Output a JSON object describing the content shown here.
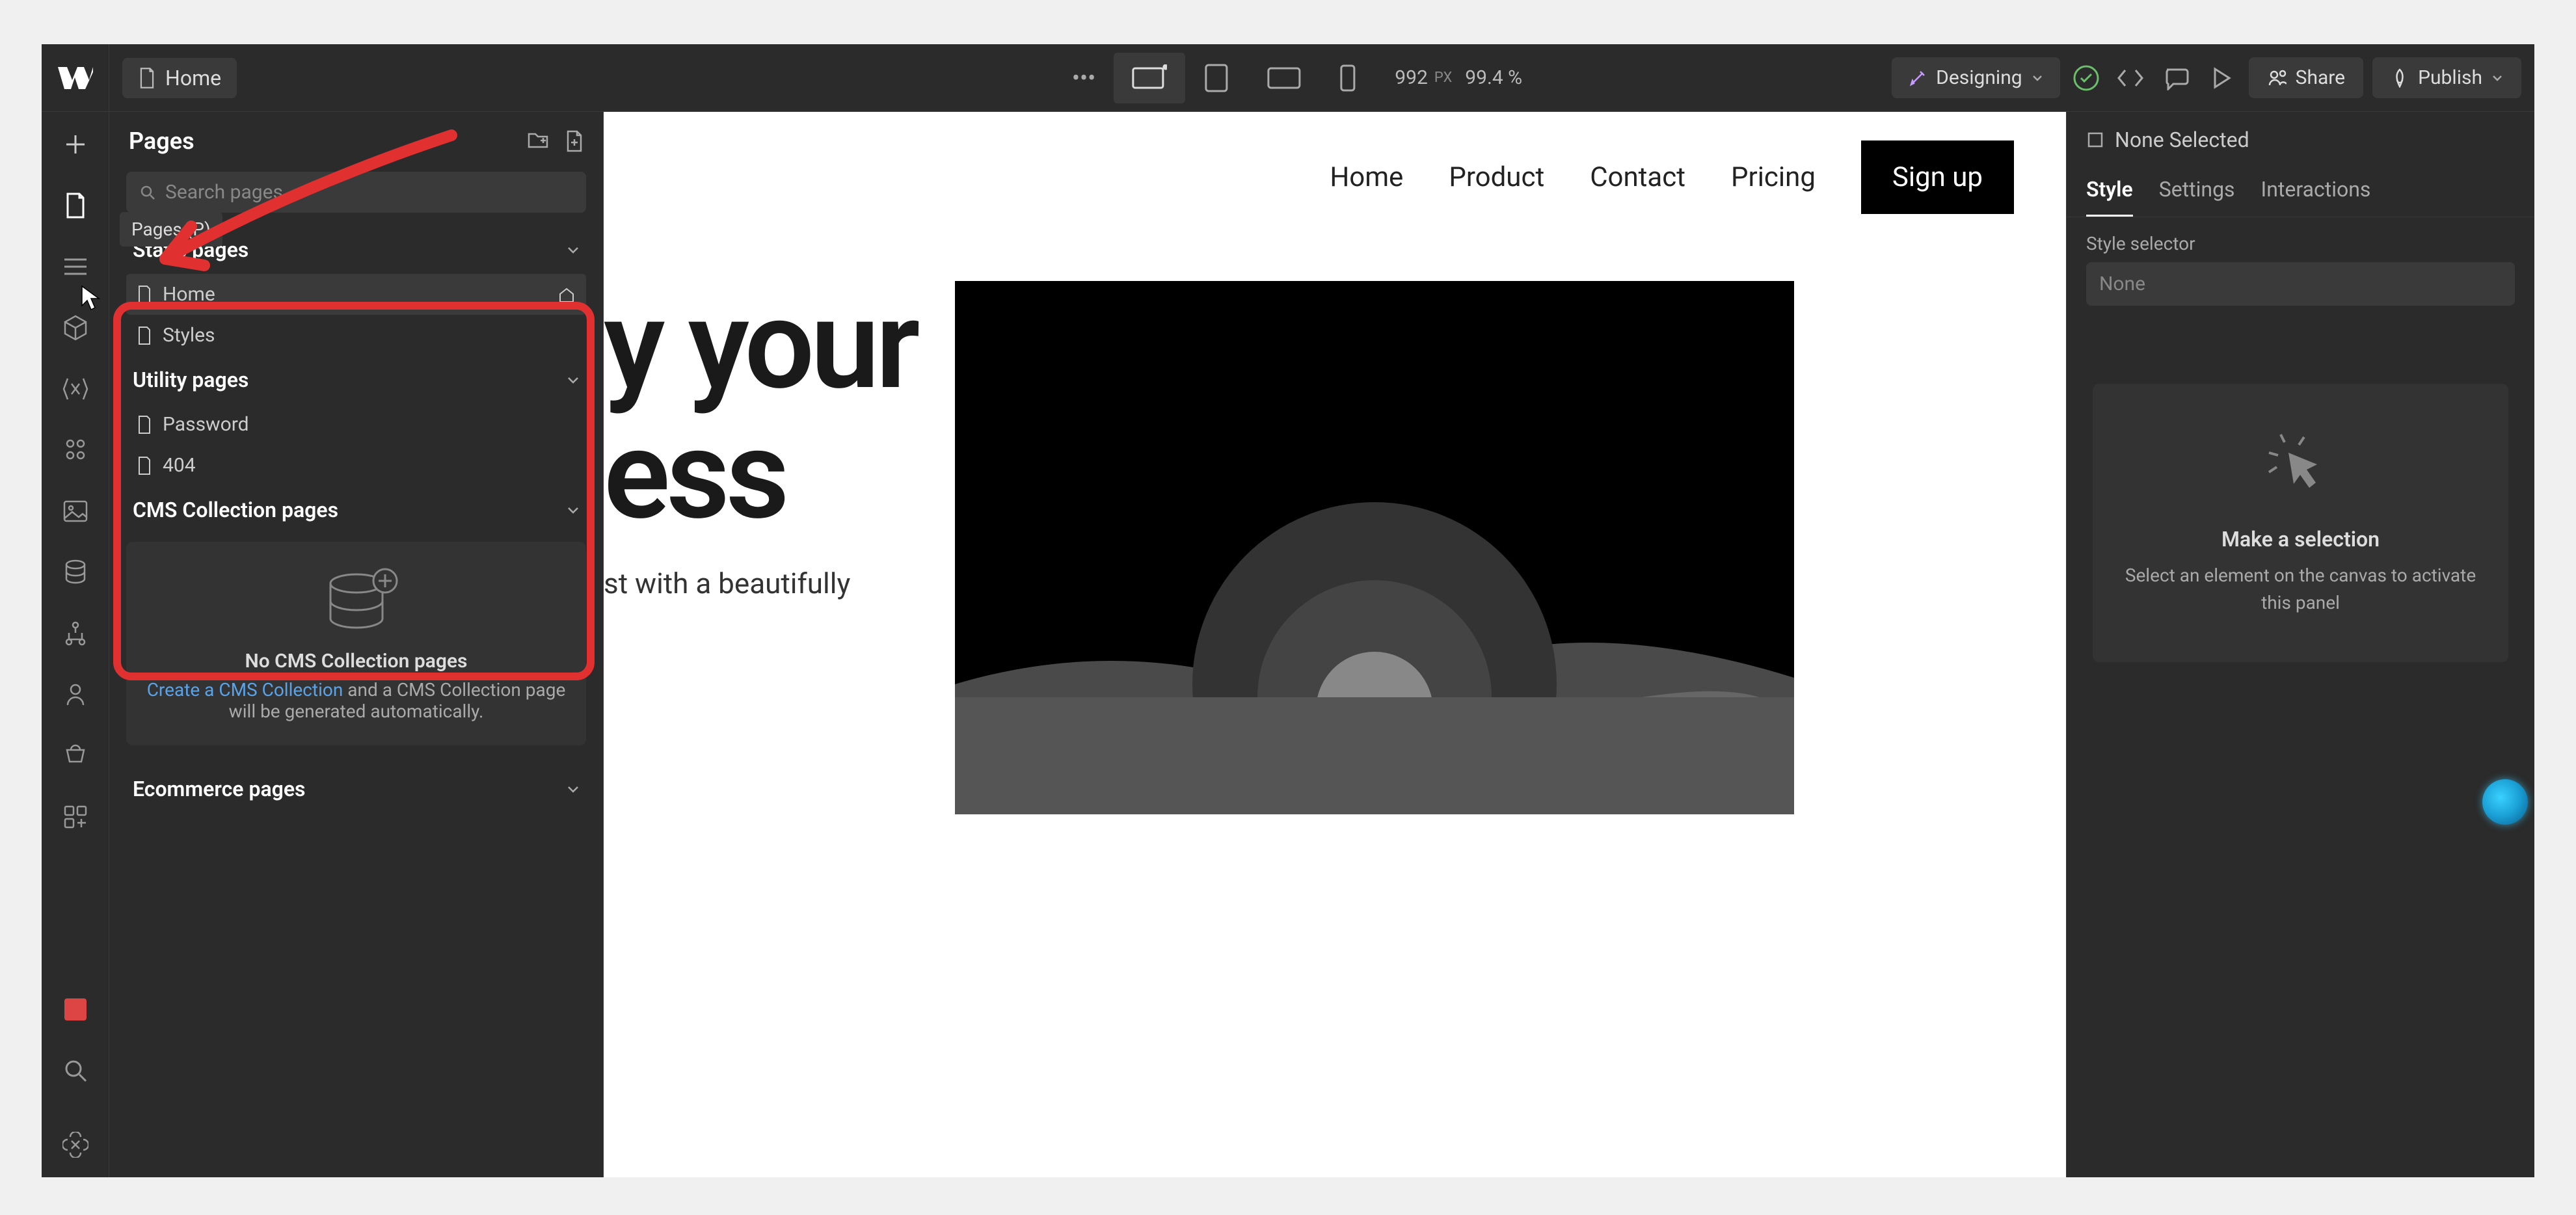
{
  "topbar": {
    "breadcrumb_page": "Home",
    "viewport_width": "992",
    "viewport_unit": "PX",
    "zoom": "99.4 %",
    "designing_label": "Designing",
    "share_label": "Share",
    "publish_label": "Publish"
  },
  "pages_panel": {
    "title": "Pages",
    "tooltip": "Pages (P)",
    "search_placeholder": "Search pages",
    "sections": {
      "static": {
        "header": "Static pages",
        "items": [
          "Home",
          "Styles"
        ]
      },
      "utility": {
        "header": "Utility pages",
        "items": [
          "Password",
          "404"
        ]
      },
      "cms": {
        "header": "CMS Collection pages",
        "empty_title": "No CMS Collection pages",
        "empty_link": "Create a CMS Collection",
        "empty_rest": " and a CMS Collection page will be generated automatically."
      },
      "ecommerce": {
        "header": "Ecommerce pages"
      }
    }
  },
  "canvas": {
    "nav": {
      "items": [
        "Home",
        "Product",
        "Contact",
        "Pricing"
      ],
      "signup": "Sign up"
    },
    "hero": {
      "line1_partial": "y your",
      "line2_partial": "ess",
      "sub_partial": "st with a beautifully"
    }
  },
  "right_panel": {
    "none_selected": "None Selected",
    "tabs": [
      "Style",
      "Settings",
      "Interactions"
    ],
    "selector_label": "Style selector",
    "selector_value": "None",
    "empty_title": "Make a selection",
    "empty_sub": "Select an element on the canvas to activate this panel"
  }
}
